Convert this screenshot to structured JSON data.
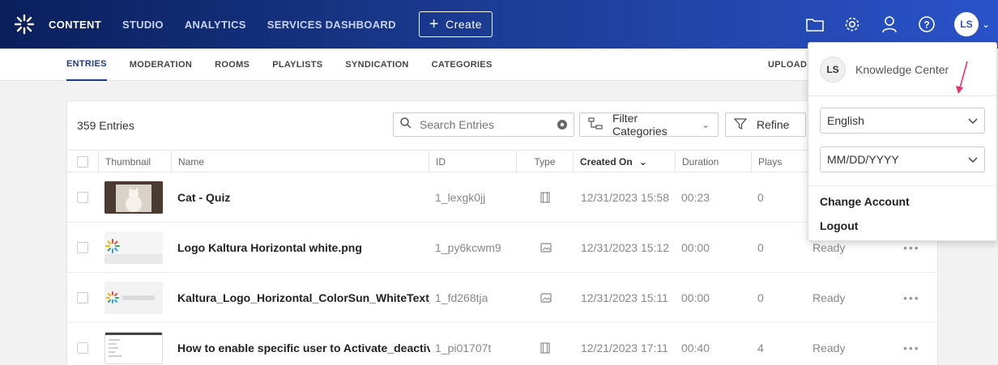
{
  "topnav": {
    "items": [
      "CONTENT",
      "STUDIO",
      "ANALYTICS",
      "SERVICES DASHBOARD"
    ],
    "create_label": "Create",
    "avatar_initials": "LS",
    "accent_color": "#2a52c9"
  },
  "subnav": {
    "items": [
      "ENTRIES",
      "MODERATION",
      "ROOMS",
      "PLAYLISTS",
      "SYNDICATION",
      "CATEGORIES"
    ],
    "upload_label": "UPLOAD"
  },
  "toolbar": {
    "entries_count": "359 Entries",
    "search_placeholder": "Search Entries",
    "filter_label": "Filter Categories",
    "refine_label": "Refine"
  },
  "table": {
    "columns": [
      "Thumbnail",
      "Name",
      "ID",
      "Type",
      "Created On",
      "Duration",
      "Plays"
    ],
    "rows": [
      {
        "name": "Cat - Quiz",
        "id": "1_lexgk0jj",
        "type": "video",
        "created": "12/31/2023 15:58",
        "duration": "00:23",
        "plays": "0",
        "status": "",
        "thumb": "cat"
      },
      {
        "name": "Logo Kaltura Horizontal white.png",
        "id": "1_py6kcwm9",
        "type": "image",
        "created": "12/31/2023 15:12",
        "duration": "00:00",
        "plays": "0",
        "status": "Ready",
        "thumb": "logo"
      },
      {
        "name": "Kaltura_Logo_Horizontal_ColorSun_WhiteText_m...",
        "id": "1_fd268tja",
        "type": "image",
        "created": "12/31/2023 15:11",
        "duration": "00:00",
        "plays": "0",
        "status": "Ready",
        "thumb": "logo-text"
      },
      {
        "name": "How to enable specific user to Activate_deactivat...",
        "id": "1_pi01707t",
        "type": "video",
        "created": "12/21/2023 17:11",
        "duration": "00:40",
        "plays": "4",
        "status": "Ready",
        "thumb": "doc"
      }
    ],
    "actions_label": "•••"
  },
  "user_menu": {
    "avatar_initials": "LS",
    "knowledge_center": "Knowledge Center",
    "language": "English",
    "date_format": "MM/DD/YYYY",
    "change_account": "Change Account",
    "logout": "Logout"
  }
}
